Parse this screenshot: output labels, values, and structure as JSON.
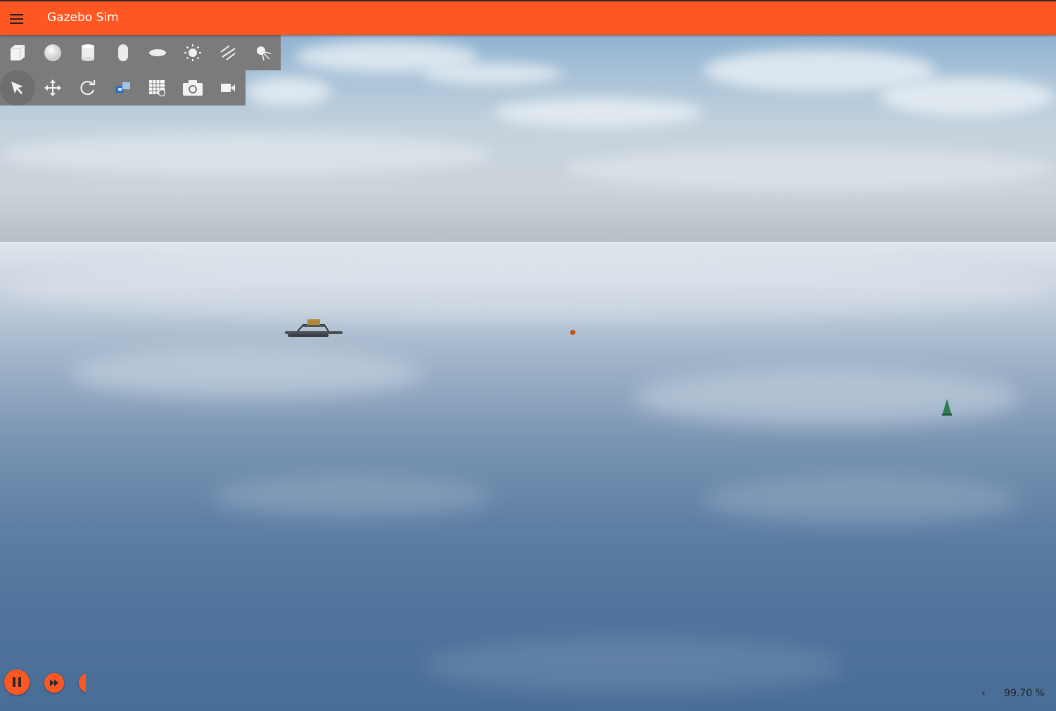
{
  "app": {
    "title": "Gazebo Sim",
    "accent_color": "#ff5722"
  },
  "shape_toolbar": {
    "items": [
      {
        "name": "box",
        "icon": "box-icon"
      },
      {
        "name": "sphere",
        "icon": "sphere-icon"
      },
      {
        "name": "cylinder",
        "icon": "cylinder-icon"
      },
      {
        "name": "capsule",
        "icon": "capsule-icon"
      },
      {
        "name": "ellipsoid",
        "icon": "ellipsoid-icon"
      },
      {
        "name": "point light",
        "icon": "point-light-icon"
      },
      {
        "name": "directional light",
        "icon": "directional-light-icon"
      },
      {
        "name": "spot light",
        "icon": "spot-light-icon"
      }
    ]
  },
  "transform_toolbar": {
    "items": [
      {
        "name": "select",
        "icon": "select-arrow-icon",
        "active": true
      },
      {
        "name": "translate",
        "icon": "translate-icon"
      },
      {
        "name": "rotate",
        "icon": "rotate-icon"
      },
      {
        "name": "snap",
        "icon": "snap-icon"
      },
      {
        "name": "grid config",
        "icon": "grid-config-icon"
      },
      {
        "name": "screenshot",
        "icon": "camera-icon"
      },
      {
        "name": "video recorder",
        "icon": "video-icon"
      }
    ]
  },
  "playback": {
    "pause": "pause-icon",
    "step": "fast-forward-icon"
  },
  "real_time_factor": {
    "value": "99.70 %",
    "collapse_glyph": "‹"
  }
}
